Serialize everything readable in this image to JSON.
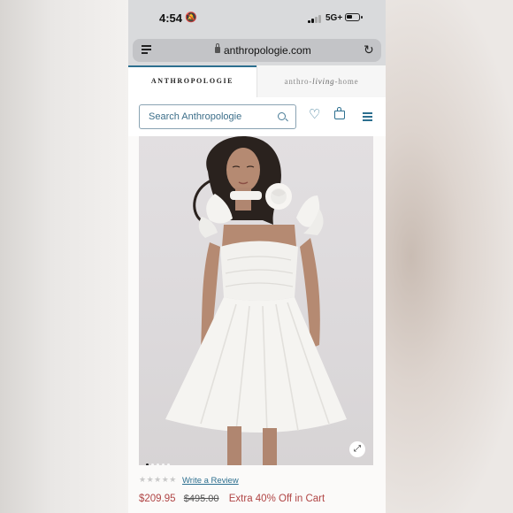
{
  "status_bar": {
    "time": "4:54",
    "network": "5G+"
  },
  "browser": {
    "url": "anthropologie.com"
  },
  "site_tabs": {
    "anthropologie": "ANTHROPOLOGIE",
    "living_prefix": "anthro-",
    "living_script": "living",
    "living_suffix": "-home"
  },
  "search": {
    "placeholder": "Search Anthropologie"
  },
  "gallery": {
    "image_count": 5,
    "active_index": 0
  },
  "reviews": {
    "stars": "★★★★★",
    "link_label": "Write a Review"
  },
  "pricing": {
    "sale_price": "$209.95",
    "original_price": "$495.00",
    "promo": "Extra 40% Off in Cart"
  },
  "colors": {
    "brand": "#2c6f8f",
    "sale": "#b04545"
  }
}
